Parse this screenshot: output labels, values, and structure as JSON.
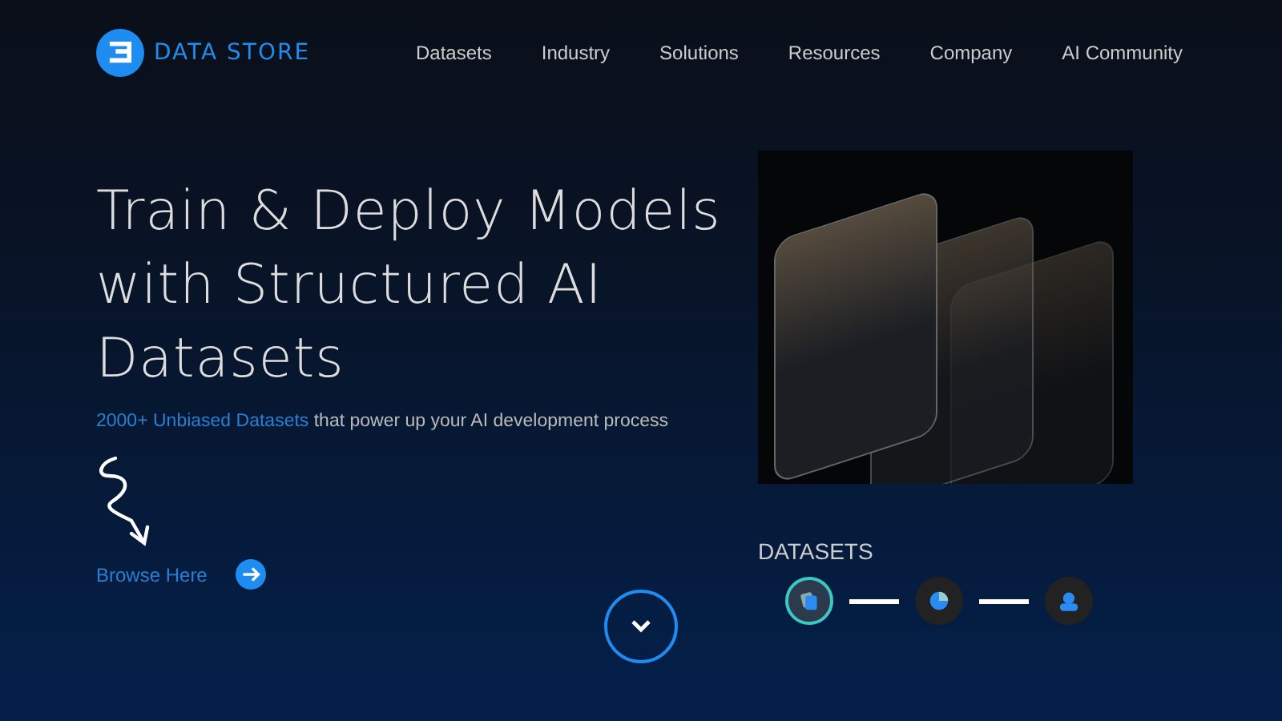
{
  "brand": {
    "name": "DATA STORE"
  },
  "nav": [
    {
      "label": "Datasets"
    },
    {
      "label": "Industry"
    },
    {
      "label": "Solutions"
    },
    {
      "label": "Resources"
    },
    {
      "label": "Company"
    },
    {
      "label": "AI Community"
    }
  ],
  "hero": {
    "heading_lines": [
      "Train & Deploy Models",
      "with Structured AI",
      "Datasets"
    ],
    "subtitle": {
      "highlight": "2000+ Unbiased Datasets",
      "rest": "that power up your AI development process"
    },
    "cta": "Browse Here"
  },
  "datasets": {
    "title": "DATASETS",
    "steps": [
      {
        "kind": "cards",
        "selected": true
      },
      {
        "kind": "chart",
        "selected": false
      },
      {
        "kind": "person",
        "selected": false
      }
    ]
  }
}
